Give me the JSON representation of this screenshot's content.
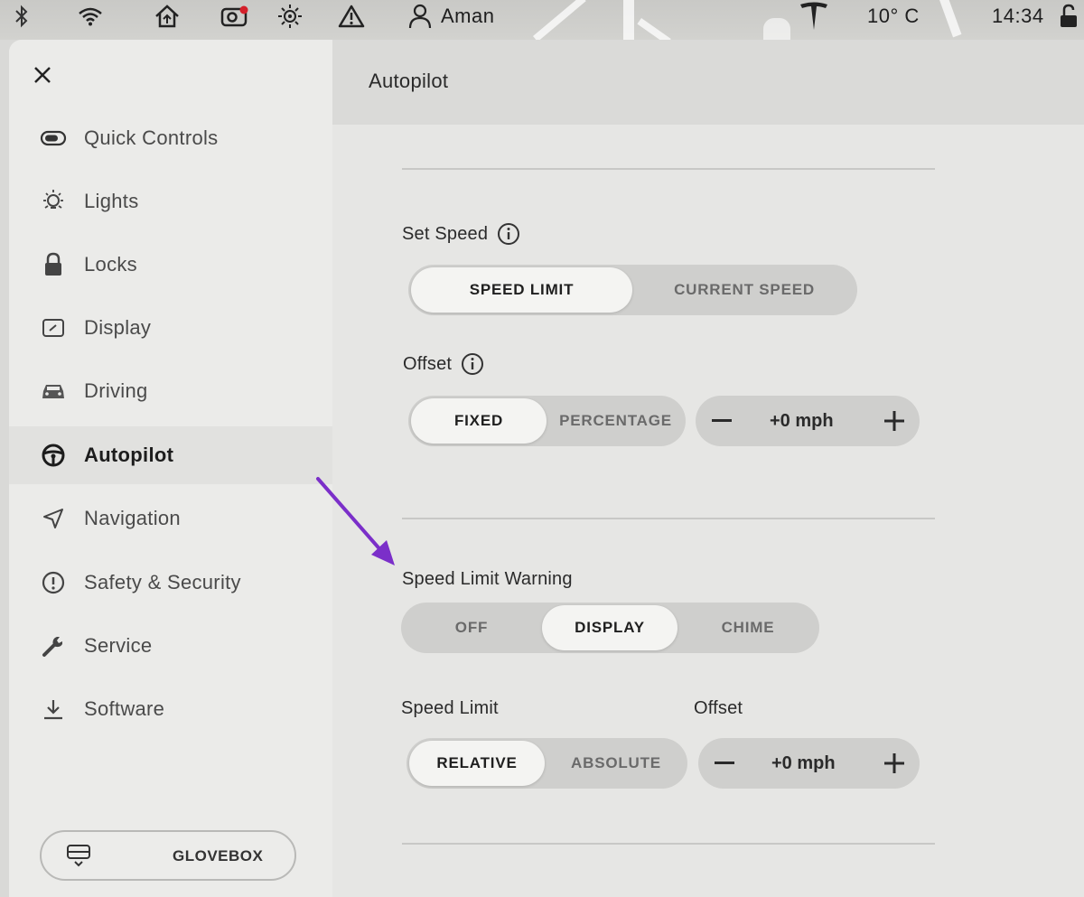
{
  "status_bar": {
    "user": "Aman",
    "temperature": "10° C",
    "time": "14:34",
    "icons": [
      "bluetooth-icon",
      "wifi-icon",
      "homelink-icon",
      "dashcam-icon",
      "sentry-icon",
      "alert-icon",
      "user-icon",
      "tesla-logo-icon",
      "unlock-icon"
    ]
  },
  "sidebar": {
    "items": [
      {
        "label": "Quick Controls",
        "icon": "toggle-icon"
      },
      {
        "label": "Lights",
        "icon": "light-bulb-icon"
      },
      {
        "label": "Locks",
        "icon": "lock-icon"
      },
      {
        "label": "Display",
        "icon": "display-icon"
      },
      {
        "label": "Driving",
        "icon": "car-icon"
      },
      {
        "label": "Autopilot",
        "icon": "steering-wheel-icon"
      },
      {
        "label": "Navigation",
        "icon": "navigation-arrow-icon"
      },
      {
        "label": "Safety & Security",
        "icon": "exclamation-circle-icon"
      },
      {
        "label": "Service",
        "icon": "wrench-icon"
      },
      {
        "label": "Software",
        "icon": "download-icon"
      }
    ],
    "active": "Autopilot",
    "glovebox_label": "GLOVEBOX"
  },
  "content": {
    "title": "Autopilot",
    "set_speed": {
      "label": "Set Speed",
      "options": [
        "SPEED LIMIT",
        "CURRENT SPEED"
      ],
      "selected": "SPEED LIMIT"
    },
    "offset": {
      "label": "Offset",
      "options": [
        "FIXED",
        "PERCENTAGE"
      ],
      "selected": "FIXED",
      "value": "+0 mph"
    },
    "speed_limit_warning": {
      "label": "Speed Limit Warning",
      "options": [
        "OFF",
        "DISPLAY",
        "CHIME"
      ],
      "selected": "DISPLAY"
    },
    "speed_limit": {
      "label": "Speed Limit",
      "options": [
        "RELATIVE",
        "ABSOLUTE"
      ],
      "selected": "RELATIVE"
    },
    "speed_limit_offset": {
      "label": "Offset",
      "value": "+0 mph"
    }
  },
  "annotation": {
    "arrow_color": "#7b2fc9"
  }
}
